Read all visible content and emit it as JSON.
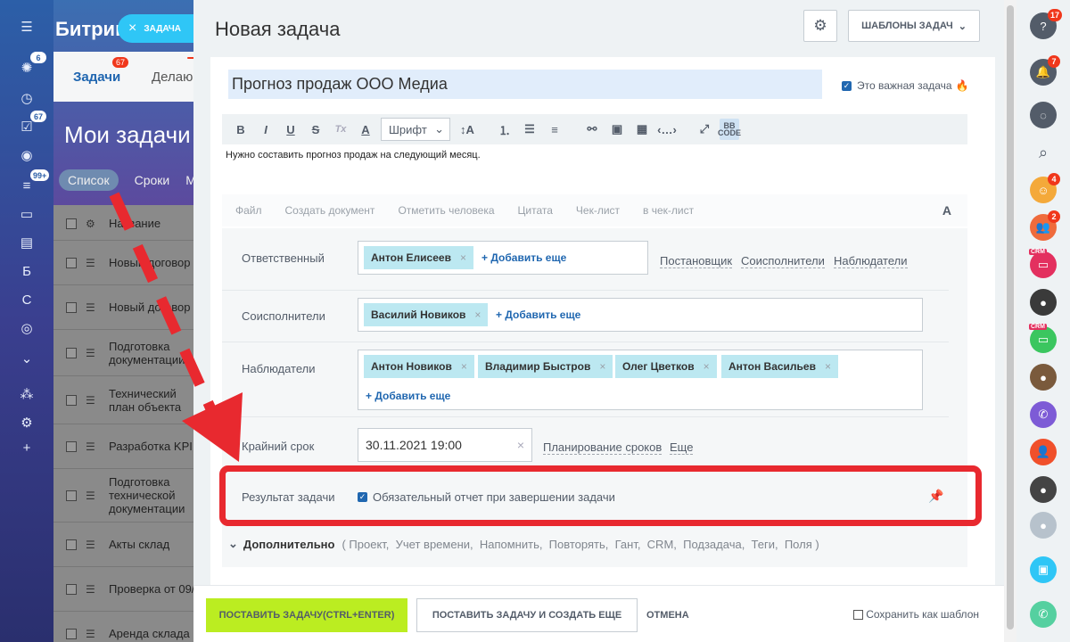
{
  "left_sidebar": {
    "items": [
      {
        "icon": "menu-icon",
        "glyph": "☰"
      },
      {
        "icon": "activity-icon",
        "glyph": "✺",
        "badge": "6"
      },
      {
        "icon": "clock-icon",
        "glyph": "◷"
      },
      {
        "icon": "tasks-icon",
        "glyph": "☑",
        "badge": "67"
      },
      {
        "icon": "robot-icon",
        "glyph": "◉"
      },
      {
        "icon": "filter-icon",
        "glyph": "≡",
        "badge": "99+"
      },
      {
        "icon": "calendar-icon",
        "glyph": "▭"
      },
      {
        "icon": "contact-icon",
        "glyph": "▤"
      },
      {
        "icon": "b-icon",
        "glyph": "Б"
      },
      {
        "icon": "c-icon",
        "glyph": "С"
      },
      {
        "icon": "target-icon",
        "glyph": "◎"
      },
      {
        "icon": "chevron-down-circle-icon",
        "glyph": "⌄"
      },
      {
        "icon": "network-icon",
        "glyph": "⁂"
      },
      {
        "icon": "gear-icon",
        "glyph": "⚙"
      },
      {
        "icon": "plus-icon",
        "glyph": "+"
      }
    ]
  },
  "background": {
    "logo": "Битрикс",
    "tab_tasks": "Задачи",
    "tab_tasks_badge": "67",
    "tab_other": "Делаю",
    "page_title": "Мои задачи",
    "filters": [
      "Список",
      "Сроки",
      "М"
    ],
    "header_label": "Название",
    "rows": [
      "Новый договор",
      "Новый договор",
      "Подготовка документации",
      "Технический план объекта",
      "Разработка KPI",
      "Подготовка технической документации",
      "Акты склад",
      "Проверка от 09/",
      "Аренда склада"
    ]
  },
  "slider_tag": "ЗАДАЧА",
  "panel": {
    "title": "Новая задача",
    "templates_button": "ШАБЛОНЫ ЗАДАЧ",
    "task_title": "Прогноз продаж  ООО Медиа",
    "important_label": "Это важная задача",
    "toolbar": {
      "font_select": "Шрифт",
      "buttons": [
        "B",
        "I",
        "U",
        "S",
        "Tx",
        "A"
      ]
    },
    "description": "Нужно составить прогноз продаж на следующий месяц.",
    "attach_links": [
      "Файл",
      "Создать документ",
      "Отметить человека",
      "Цитата",
      "Чек-лист",
      "в чек-лист"
    ],
    "attach_format": "A",
    "responsible": {
      "label": "Ответственный",
      "people": [
        "Антон Елисеев"
      ],
      "add": "+ Добавить еще",
      "links": [
        "Постановщик",
        "Соисполнители",
        "Наблюдатели"
      ]
    },
    "coexecutors": {
      "label": "Соисполнители",
      "people": [
        "Василий Новиков"
      ],
      "add": "+ Добавить еще"
    },
    "observers": {
      "label": "Наблюдатели",
      "people": [
        "Антон Новиков",
        "Владимир Быстров",
        "Олег Цветков",
        "Антон Васильев"
      ],
      "add": "+ Добавить еще"
    },
    "deadline": {
      "label": "Крайний срок",
      "value": "30.11.2021 19:00",
      "links": [
        "Планирование сроков",
        "Еще"
      ]
    },
    "result": {
      "label": "Результат задачи",
      "checkbox_label": "Обязательный отчет при завершении задачи"
    },
    "extra": {
      "label": "Дополнительно",
      "items": "( Проект,  Учет времени,  Напомнить,  Повторять,  Гант,  CRM,  Подзадача,  Теги,  Поля )"
    },
    "footer": {
      "submit": "ПОСТАВИТЬ ЗАДАЧУ(CTRL+ENTER)",
      "submit_more": "ПОСТАВИТЬ ЗАДАЧУ И СОЗДАТЬ ЕЩЕ",
      "cancel": "ОТМЕНА",
      "save_template": "Сохранить как шаблон"
    }
  },
  "right_sidebar": {
    "items": [
      {
        "icon": "help-icon",
        "glyph": "?",
        "color": "#535c69",
        "badge": "17"
      },
      {
        "icon": "bell-icon",
        "glyph": "🔔",
        "color": "#535c69",
        "badge": "7"
      },
      {
        "icon": "chat-icon",
        "glyph": "◌",
        "color": "#535c69"
      },
      {
        "icon": "search-icon",
        "glyph": "⌕",
        "color": "transparent"
      },
      {
        "icon": "avatar-icon",
        "glyph": "☺",
        "color": "#f4a93a",
        "badge": "4"
      },
      {
        "icon": "group-icon",
        "glyph": "👥",
        "color": "#ef6b3c",
        "badge": "2"
      },
      {
        "icon": "crm-icon",
        "glyph": "▭",
        "color": "#e3305f",
        "crm": "CRM"
      },
      {
        "icon": "avatar-icon",
        "glyph": "●",
        "color": "#3a3a3a"
      },
      {
        "icon": "crm-icon",
        "glyph": "▭",
        "color": "#3bc65f",
        "crm": "CRM"
      },
      {
        "icon": "avatar-icon",
        "glyph": "●",
        "color": "#7a5a3c"
      },
      {
        "icon": "viber-icon",
        "glyph": "✆",
        "color": "#7d5bd6"
      },
      {
        "icon": "user-icon",
        "glyph": "👤",
        "color": "#f0502b"
      },
      {
        "icon": "avatar-icon",
        "glyph": "●",
        "color": "#444"
      },
      {
        "icon": "avatar-icon",
        "glyph": "●",
        "color": "#b7c2cc"
      },
      {
        "icon": "phone-copy-icon",
        "glyph": "▣",
        "color": "#2fc6f6"
      },
      {
        "icon": "phone-icon",
        "glyph": "✆",
        "color": "#55d0a0"
      }
    ]
  },
  "colors": {
    "accent": "#2067b0",
    "submit": "#bbed21",
    "chip": "#bce8f1",
    "highlight": "#e8292f"
  }
}
